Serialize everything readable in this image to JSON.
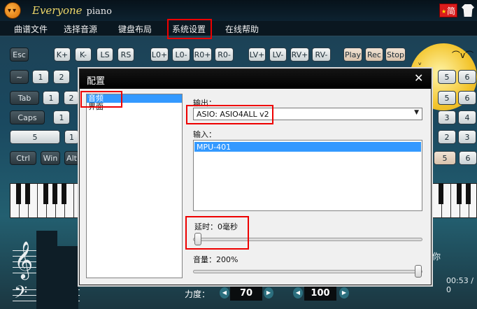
{
  "app": {
    "title": "Everyone",
    "title_sub": "piano",
    "lang_flag": "简"
  },
  "menu": {
    "items": [
      "曲谱文件",
      "选择音源",
      "键盘布局",
      "系统设置",
      "在线帮助"
    ]
  },
  "keyboard": {
    "row_func": [
      "Esc",
      "K+",
      "K-",
      "LS",
      "RS",
      "L0+",
      "L0-",
      "R0+",
      "R0-",
      "LV+",
      "LV-",
      "RV+",
      "RV-",
      "Play",
      "Rec",
      "Stop"
    ],
    "left": {
      "tilde": "~",
      "tab": "Tab",
      "caps": "Caps",
      "ctrl": "Ctrl",
      "win": "Win",
      "alt": "Alt",
      "n1": "1",
      "n2": "2",
      "n5": "5"
    },
    "right": {
      "r5": "5",
      "r6": "6",
      "r2": "2",
      "r3": "3",
      "r4": "4",
      "r1": "1"
    }
  },
  "right_panel": {
    "ni": "你",
    "time": "00:53 / 0"
  },
  "bottom": {
    "strength_label": "力度：",
    "strength_value": "70",
    "second_value": "100"
  },
  "dialog": {
    "title": "配置",
    "close": "✕",
    "categories": [
      {
        "label": "音频",
        "selected": true
      },
      {
        "label": "界面",
        "selected": false
      }
    ],
    "output_label": "输出：",
    "output_value": "ASIO: ASIO4ALL v2",
    "input_label": "输入：",
    "input_items": [
      "MPU-401"
    ],
    "latency_label": "延时：0毫秒",
    "latency_ms": 0,
    "volume_label": "音量：200%",
    "volume_fraction": 1.0
  },
  "colors": {
    "highlight_red": "#e00000",
    "selection_blue": "#3399ff",
    "dialog_bg": "#f0f0f0"
  }
}
